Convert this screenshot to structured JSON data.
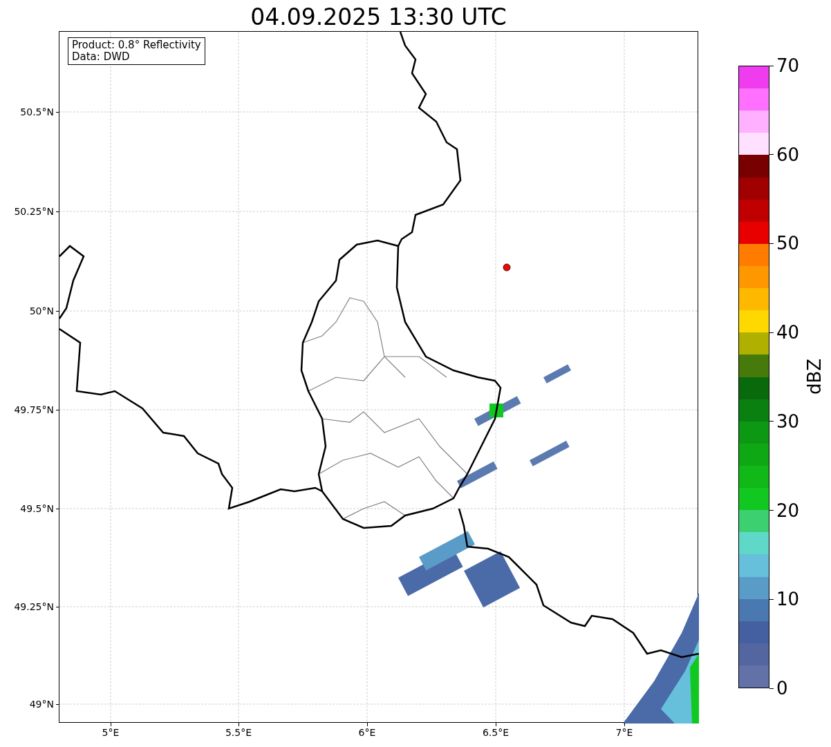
{
  "title": "04.09.2025 13:30 UTC",
  "map": {
    "info_lines": [
      "Product: 0.8° Reflectivity",
      "Data: DWD"
    ],
    "x_ticks": [
      "5°E",
      "5.5°E",
      "6°E",
      "6.5°E",
      "7°E"
    ],
    "y_ticks": [
      "50.5°N",
      "50.25°N",
      "50°N",
      "49.75°N",
      "49.5°N",
      "49.25°N",
      "49°N"
    ]
  },
  "colorbar": {
    "label": "dBZ",
    "ticks": [
      "70",
      "60",
      "50",
      "40",
      "30",
      "20",
      "10",
      "0"
    ],
    "bins": [
      {
        "color": "#ee3cee"
      },
      {
        "color": "#ff70ff"
      },
      {
        "color": "#ffb0ff"
      },
      {
        "color": "#ffe0ff"
      },
      {
        "color": "#780000"
      },
      {
        "color": "#a00000"
      },
      {
        "color": "#c00000"
      },
      {
        "color": "#e80000"
      },
      {
        "color": "#ff7c00"
      },
      {
        "color": "#ff9800"
      },
      {
        "color": "#ffb800"
      },
      {
        "color": "#ffd800"
      },
      {
        "color": "#b0b000"
      },
      {
        "color": "#467a0a"
      },
      {
        "color": "#086a0c"
      },
      {
        "color": "#0a8010"
      },
      {
        "color": "#0c9812"
      },
      {
        "color": "#0ea814"
      },
      {
        "color": "#10b818"
      },
      {
        "color": "#10c820"
      },
      {
        "color": "#3cd070"
      },
      {
        "color": "#60d8c8"
      },
      {
        "color": "#66c0dc"
      },
      {
        "color": "#5a9cc8"
      },
      {
        "color": "#4a78b0"
      },
      {
        "color": "#4460a0"
      },
      {
        "color": "#5366a0"
      },
      {
        "color": "#6272a8"
      }
    ]
  }
}
